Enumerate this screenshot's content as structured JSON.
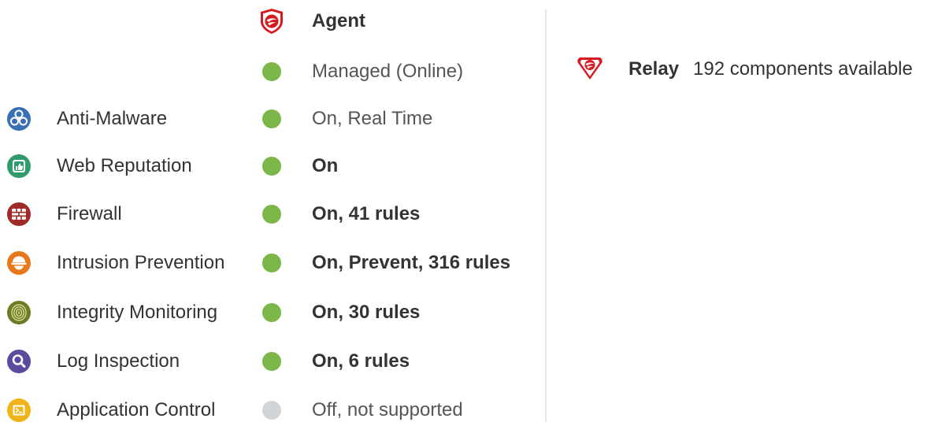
{
  "agent": {
    "title": "Agent",
    "icon": "trend-micro-shield-icon",
    "managed_status": "Managed (Online)",
    "managed_state": "online"
  },
  "modules": [
    {
      "label": "Anti-Malware",
      "icon": "biohazard-icon",
      "status": "On, Real Time",
      "state": "on"
    },
    {
      "label": "Web Reputation",
      "icon": "thumbs-up-icon",
      "status": "On",
      "state": "on"
    },
    {
      "label": "Firewall",
      "icon": "brick-wall-icon",
      "status": "On, 41 rules",
      "state": "on"
    },
    {
      "label": "Intrusion Prevention",
      "icon": "intrusion-prevention-icon",
      "status": "On, Prevent, 316 rules",
      "state": "on"
    },
    {
      "label": "Integrity Monitoring",
      "icon": "fingerprint-icon",
      "status": "On, 30 rules",
      "state": "on"
    },
    {
      "label": "Log Inspection",
      "icon": "magnifier-icon",
      "status": "On, 6 rules",
      "state": "on"
    },
    {
      "label": "Application Control",
      "icon": "app-window-icon",
      "status": "Off, not supported",
      "state": "off"
    }
  ],
  "relay": {
    "label": "Relay",
    "detail": "192 components available",
    "icon": "trend-micro-relay-icon"
  },
  "colors": {
    "status_on": "#7ab648",
    "status_off": "#d2d5d8",
    "brand_red": "#d71920",
    "anti_malware": "#3a6fb5",
    "web_reputation": "#2f9a6b",
    "firewall": "#a02a2a",
    "intrusion_prevention": "#e8791a",
    "integrity_monitoring": "#6f7a22",
    "log_inspection": "#5b4a9e",
    "application_control": "#f0b41a"
  }
}
